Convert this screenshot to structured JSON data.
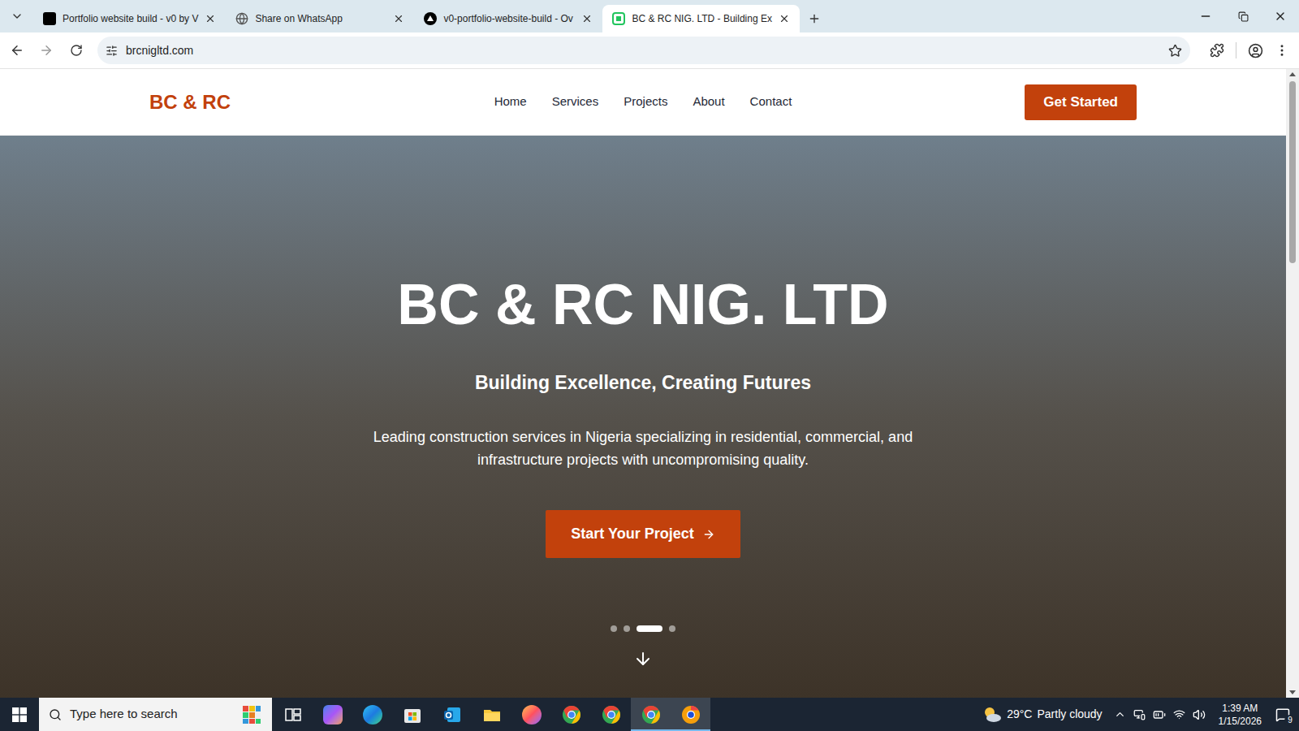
{
  "browser": {
    "tabs": [
      {
        "label": "Portfolio website build - v0 by V",
        "kind": "v0",
        "selected": false
      },
      {
        "label": "Share on WhatsApp",
        "kind": "globe",
        "selected": false
      },
      {
        "label": "v0-portfolio-website-build - Ov",
        "kind": "vercel",
        "selected": false
      },
      {
        "label": "BC & RC NIG. LTD - Building Ex",
        "kind": "site",
        "selected": true
      }
    ],
    "address": "brcnigltd.com"
  },
  "site": {
    "logo": "BC & RC",
    "nav": [
      "Home",
      "Services",
      "Projects",
      "About",
      "Contact"
    ],
    "cta": "Get Started",
    "hero": {
      "title": "BC & RC NIG. LTD",
      "tagline": "Building Excellence, Creating Futures",
      "description": "Leading construction services in Nigeria specializing in residential, commercial, and infrastructure projects with uncompromising quality.",
      "button": "Start Your Project",
      "slides": [
        {
          "selected": false
        },
        {
          "selected": false
        },
        {
          "selected": true
        },
        {
          "selected": false
        }
      ]
    }
  },
  "taskbar": {
    "search": {
      "placeholder": "Type here to search"
    },
    "apps": [
      {
        "kind": "task-view",
        "active": false
      },
      {
        "kind": "copilot",
        "active": false
      },
      {
        "kind": "edge",
        "active": false
      },
      {
        "kind": "store",
        "active": false
      },
      {
        "kind": "outlook",
        "active": false
      },
      {
        "kind": "files",
        "active": false
      },
      {
        "kind": "firefox",
        "active": false
      },
      {
        "kind": "chrome",
        "active": false
      },
      {
        "kind": "chrome",
        "active": false
      },
      {
        "kind": "chrome",
        "active": true
      },
      {
        "kind": "chrome-orange",
        "active": true
      }
    ],
    "weather": {
      "temperature": "29°C",
      "condition": "Partly cloudy"
    },
    "clock": {
      "time": "1:39 AM",
      "date": "1/15/2026"
    },
    "notifications": "9"
  }
}
